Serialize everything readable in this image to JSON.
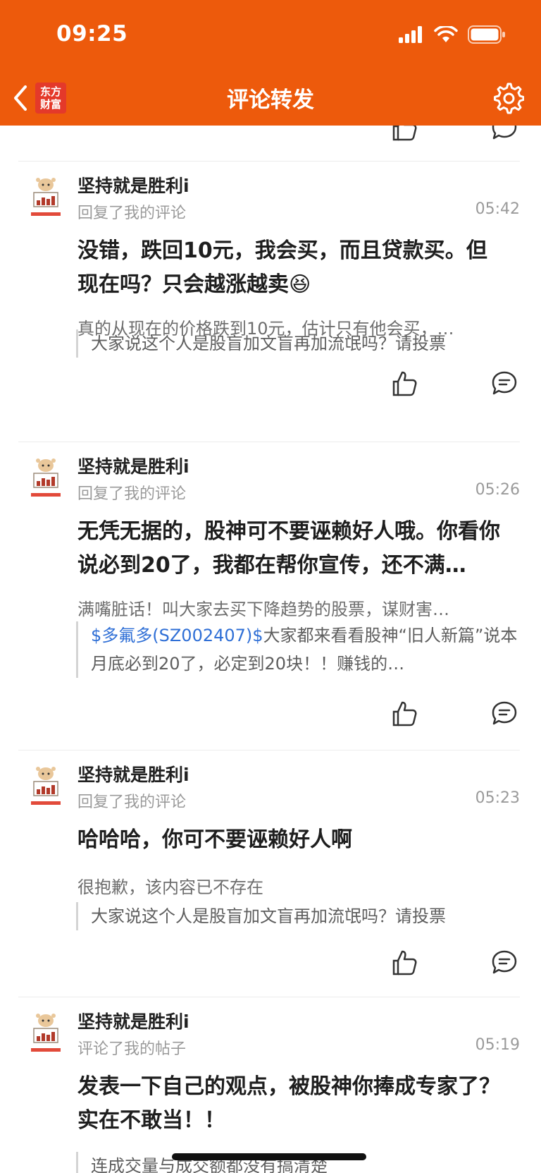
{
  "status_bar": {
    "time": "09:25"
  },
  "nav": {
    "logo_line1": "东方",
    "logo_line2": "财富",
    "title": "评论转发"
  },
  "colors": {
    "brand": "#ED5A0C",
    "link": "#2f6fd6",
    "logo": "#E4392A"
  },
  "icons": [
    "chevron-left-icon",
    "gear-icon",
    "thumbs-up-icon",
    "comment-bubble-icon",
    "signal-icon",
    "wifi-icon",
    "battery-icon"
  ],
  "comments": [
    {
      "username": "坚持就是胜利i",
      "action": "回复了我的评论",
      "time": "05:42",
      "text": "没错，跌回10元，我会买，而且贷款买。但现在吗？只会越涨越卖",
      "emoji": "😆",
      "sub": "真的从现在的价格跌到10元，估计只有他会买，…",
      "quote_tag": "",
      "quote": "大家说这个人是股盲加文盲再加流氓吗？请投票"
    },
    {
      "username": "坚持就是胜利i",
      "action": "回复了我的评论",
      "time": "05:26",
      "text": "无凭无据的，股神可不要诬赖好人哦。你看你说必到20了，我都在帮你宣传，还不满…",
      "emoji": "",
      "sub": "满嘴脏话！叫大家去买下降趋势的股票，谋财害…",
      "quote_tag": "$多氟多(SZ002407)$",
      "quote": "大家都来看看股神“旧人新篇”说本月底必到20了，必定到20块！！赚钱的…"
    },
    {
      "username": "坚持就是胜利i",
      "action": "回复了我的评论",
      "time": "05:23",
      "text": "哈哈哈，你可不要诬赖好人啊",
      "emoji": "",
      "sub": "很抱歉，该内容已不存在",
      "quote_tag": "",
      "quote": "大家说这个人是股盲加文盲再加流氓吗？请投票"
    },
    {
      "username": "坚持就是胜利i",
      "action": "评论了我的帖子",
      "time": "05:19",
      "text": "发表一下自己的观点，被股神你捧成专家了？实在不敢当！！",
      "emoji": "",
      "sub": "",
      "quote_tag": "",
      "quote": "连成交量与成交额都没有搞清楚"
    }
  ]
}
